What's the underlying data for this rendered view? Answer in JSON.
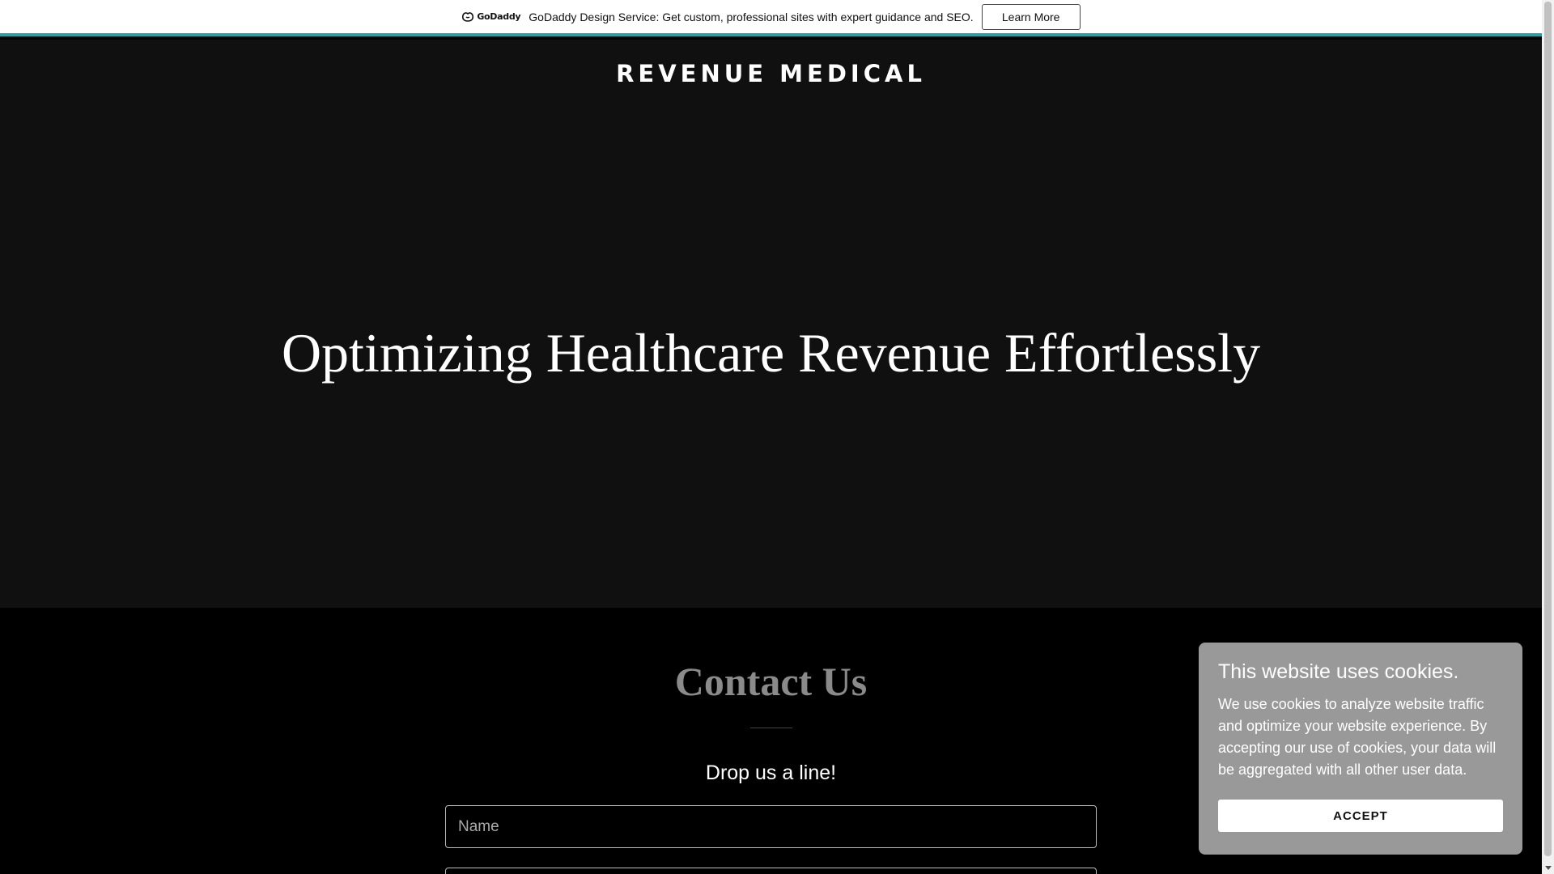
{
  "promo": {
    "logo_text": "GoDaddy",
    "message": "GoDaddy Design Service: Get custom, professional sites with expert guidance and SEO.",
    "button_label": "Learn More"
  },
  "hero": {
    "site_title": "REVENUE MEDICAL",
    "heading": "Optimizing Healthcare Revenue Effortlessly"
  },
  "contact": {
    "title": "Contact Us",
    "subtitle": "Drop us a line!",
    "name_placeholder": "Name"
  },
  "cookie": {
    "title": "This website uses cookies.",
    "body": "We use cookies to analyze website traffic and optimize your website experience. By accepting our use of cookies, your data will be aggregated with all other user data.",
    "accept_label": "ACCEPT"
  },
  "colors": {
    "accent": "#1fa3a8",
    "hero_bg": "#101010",
    "cookie_bg": "#999999"
  },
  "icons": {
    "logo": "godaddy-logo-icon",
    "scroll_down": "chevron-down-icon"
  }
}
